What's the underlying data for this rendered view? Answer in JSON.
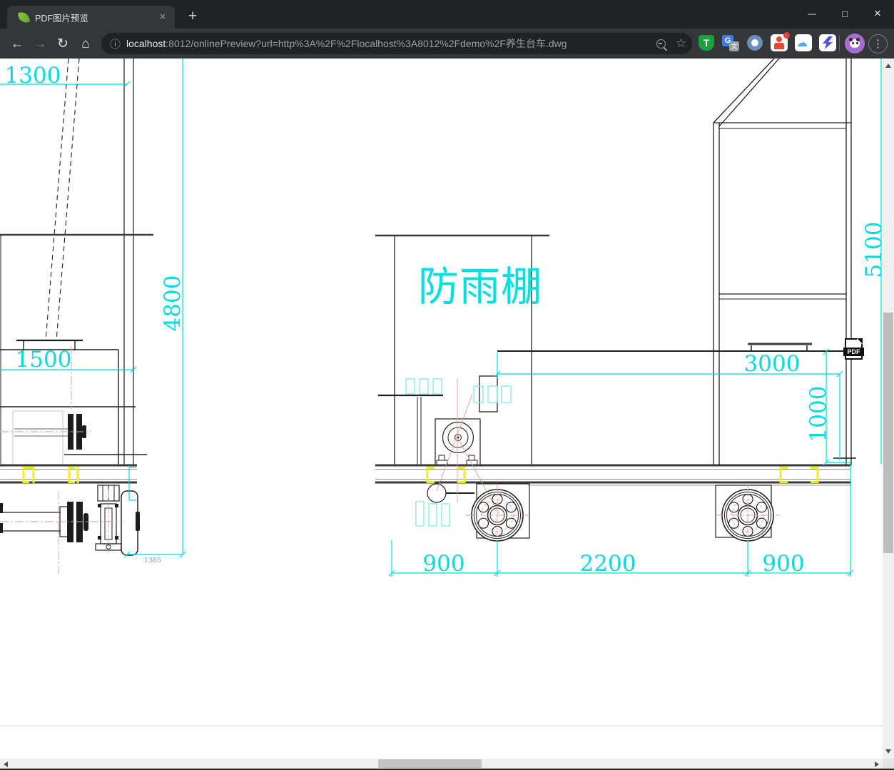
{
  "window": {
    "minimize_glyph": "—",
    "maximize_glyph": "□",
    "close_glyph": "×"
  },
  "browser": {
    "tab": {
      "title": "PDF图片预览",
      "close_glyph": "×",
      "new_tab_glyph": "+"
    },
    "toolbar": {
      "back_glyph": "←",
      "forward_glyph": "→",
      "reload_glyph": "↻",
      "home_glyph": "⌂",
      "info_glyph": "ⓘ",
      "bookmark_glyph": "☆",
      "menu_glyph": "⋮",
      "cloud_glyph": "☁",
      "extension_labels": {
        "tampermonkey": "T",
        "translate_g": "G",
        "translate_wen": "文"
      }
    },
    "address": {
      "host": "localhost",
      "path": ":8012/onlinePreview?url=http%3A%2F%2Flocalhost%3A8012%2Fdemo%2F养生台车.dwg"
    }
  },
  "drawing": {
    "canopy_label": "防雨棚",
    "pdf_badge": "PDF",
    "dims": {
      "top_left": "1300",
      "mid_left": "1500",
      "height_left": "4800",
      "height_right": "5100",
      "deck_length": "3000",
      "deck_height": "1000",
      "axle_offset": "1385",
      "wheel_left": "900",
      "wheel_span": "2200",
      "wheel_right": "900"
    }
  },
  "colors": {
    "dimension_cyan": "#00dcdc",
    "highlight_yellow": "#ecec2a",
    "centerline_pink": "#e09c98",
    "accent_blue": "#2a8af6"
  }
}
